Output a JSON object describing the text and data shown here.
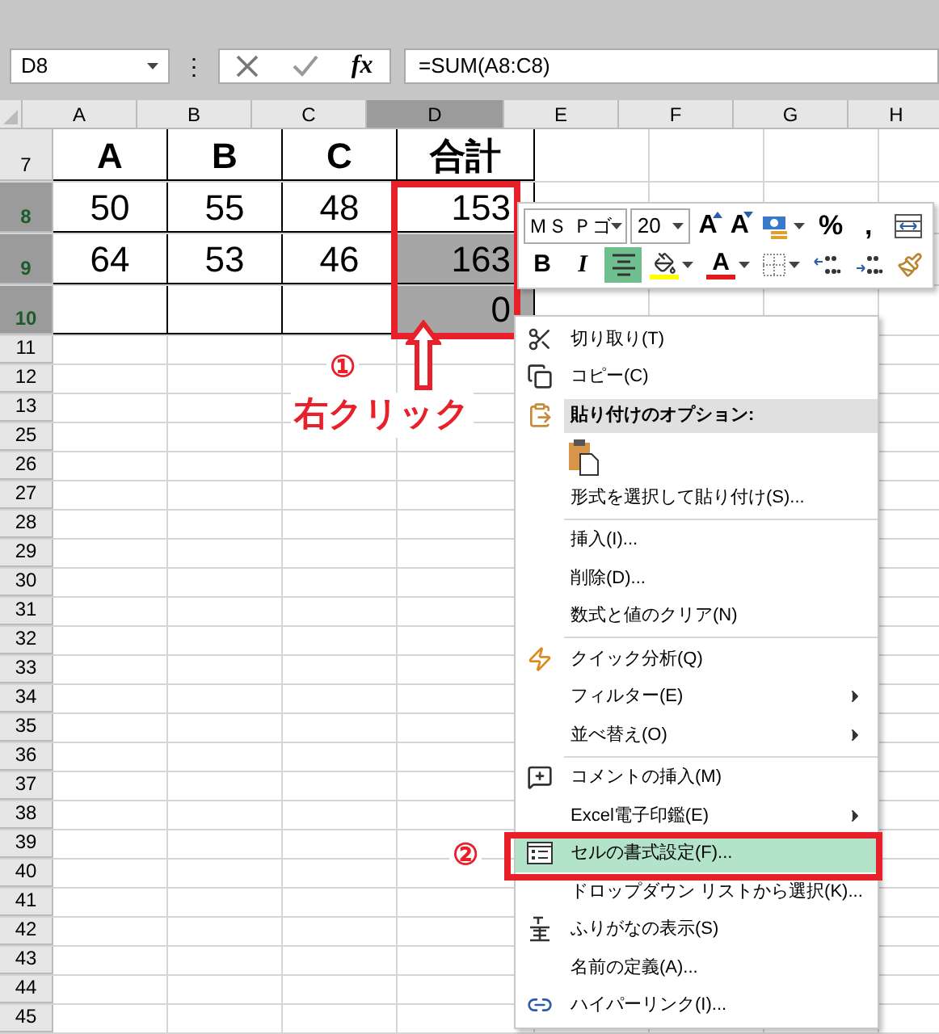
{
  "formula_bar": {
    "name_box": "D8",
    "more": "⋮",
    "function_label": "fx",
    "formula": "=SUM(A8:C8)"
  },
  "columns": [
    {
      "label": "A",
      "selected": false
    },
    {
      "label": "B",
      "selected": false
    },
    {
      "label": "C",
      "selected": false
    },
    {
      "label": "D",
      "selected": true
    },
    {
      "label": "E",
      "selected": false
    },
    {
      "label": "F",
      "selected": false
    },
    {
      "label": "G",
      "selected": false
    },
    {
      "label": "H",
      "selected": false
    }
  ],
  "rows": [
    {
      "label": "7",
      "selected": false,
      "cells": [
        {
          "text": "A",
          "selected": false
        },
        {
          "text": "B",
          "selected": false
        },
        {
          "text": "C",
          "selected": false
        },
        {
          "text": "合計",
          "selected": false
        }
      ]
    },
    {
      "label": "8",
      "selected": true,
      "cells": [
        {
          "text": "50",
          "selected": false
        },
        {
          "text": "55",
          "selected": false
        },
        {
          "text": "48",
          "selected": false
        },
        {
          "text": "153",
          "selected": false
        }
      ]
    },
    {
      "label": "9",
      "selected": true,
      "cells": [
        {
          "text": "64",
          "selected": false
        },
        {
          "text": "53",
          "selected": false
        },
        {
          "text": "46",
          "selected": false
        },
        {
          "text": "163",
          "selected": true
        }
      ]
    },
    {
      "label": "10",
      "selected": true,
      "cells": [
        {
          "selected": false
        },
        {
          "selected": false
        },
        {
          "selected": false
        },
        {
          "text": "0",
          "selected": true
        }
      ]
    },
    {
      "label": "11",
      "selected": false
    },
    {
      "label": "12",
      "selected": false
    },
    {
      "label": "13",
      "selected": false
    },
    {
      "label": "25",
      "selected": false
    },
    {
      "label": "26",
      "selected": false
    },
    {
      "label": "27",
      "selected": false
    },
    {
      "label": "28",
      "selected": false
    },
    {
      "label": "29",
      "selected": false
    },
    {
      "label": "30",
      "selected": false
    },
    {
      "label": "31",
      "selected": false
    },
    {
      "label": "32",
      "selected": false
    },
    {
      "label": "33",
      "selected": false
    },
    {
      "label": "34",
      "selected": false
    },
    {
      "label": "35",
      "selected": false
    },
    {
      "label": "36",
      "selected": false
    },
    {
      "label": "37",
      "selected": false
    },
    {
      "label": "38",
      "selected": false
    },
    {
      "label": "39",
      "selected": false
    },
    {
      "label": "40",
      "selected": false
    },
    {
      "label": "41",
      "selected": false
    },
    {
      "label": "42",
      "selected": false
    },
    {
      "label": "43",
      "selected": false
    },
    {
      "label": "44",
      "selected": false
    },
    {
      "label": "45",
      "selected": false
    }
  ],
  "mini_toolbar": {
    "font": "ＭＳ Ｐゴ",
    "size": "20",
    "rows": [
      [
        {
          "kind": "grow",
          "label": "A"
        },
        {
          "kind": "shrink",
          "label": "A"
        },
        {
          "kind": "accounting"
        },
        {
          "kind": "text",
          "label": "%"
        },
        {
          "kind": "text",
          "label": ","
        },
        {
          "kind": "wrap"
        }
      ],
      [
        {
          "kind": "bold",
          "label": "B",
          "selected": false
        },
        {
          "kind": "italic",
          "label": "I",
          "selected": false
        },
        {
          "kind": "align",
          "selected": true
        },
        {
          "kind": "fill"
        },
        {
          "kind": "font-color",
          "label": "A"
        },
        {
          "kind": "borders"
        },
        {
          "kind": "inc-decimal"
        },
        {
          "kind": "dec-decimal"
        },
        {
          "kind": "painter"
        }
      ]
    ]
  },
  "context_menu": [
    {
      "kind": "item",
      "label": "切り取り(T)",
      "submenu": false,
      "selected": false
    },
    {
      "kind": "item",
      "label": "コピー(C)",
      "submenu": false,
      "selected": false
    },
    {
      "kind": "header",
      "label": "貼り付けのオプション:"
    },
    {
      "kind": "paste-options"
    },
    {
      "kind": "item",
      "label": "形式を選択して貼り付け(S)...",
      "submenu": false,
      "selected": false
    },
    {
      "kind": "separator"
    },
    {
      "kind": "item",
      "label": "挿入(I)...",
      "submenu": false,
      "selected": false
    },
    {
      "kind": "item",
      "label": "削除(D)...",
      "submenu": false,
      "selected": false
    },
    {
      "kind": "item",
      "label": "数式と値のクリア(N)",
      "submenu": false,
      "selected": false
    },
    {
      "kind": "separator"
    },
    {
      "kind": "item",
      "label": "クイック分析(Q)",
      "submenu": false,
      "selected": false
    },
    {
      "kind": "item",
      "label": "フィルター(E)",
      "submenu": true,
      "selected": false
    },
    {
      "kind": "item",
      "label": "並べ替え(O)",
      "submenu": true,
      "selected": false
    },
    {
      "kind": "separator"
    },
    {
      "kind": "item",
      "label": "コメントの挿入(M)",
      "submenu": false,
      "selected": false
    },
    {
      "kind": "item",
      "label": "Excel電子印鑑(E)",
      "submenu": true,
      "selected": false
    },
    {
      "kind": "item",
      "label": "セルの書式設定(F)...",
      "submenu": false,
      "selected": true
    },
    {
      "kind": "item",
      "label": "ドロップダウン リストから選択(K)...",
      "submenu": false,
      "selected": false
    },
    {
      "kind": "item",
      "label": "ふりがなの表示(S)",
      "submenu": false,
      "selected": false
    },
    {
      "kind": "item",
      "label": "名前の定義(A)...",
      "submenu": false,
      "selected": false
    },
    {
      "kind": "item",
      "label": "ハイパーリンク(I)...",
      "submenu": false,
      "selected": false
    }
  ],
  "annotations": {
    "step1_number": "①",
    "step1_label": "右クリック",
    "step2_number": "②"
  }
}
